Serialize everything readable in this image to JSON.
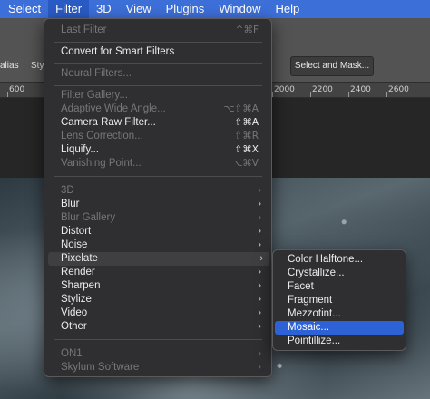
{
  "menubar": {
    "items": [
      "Select",
      "Filter",
      "3D",
      "View",
      "Plugins",
      "Window",
      "Help"
    ],
    "active": "Filter"
  },
  "options_bar": {
    "fragment_1": "alias",
    "fragment_2": "Sty",
    "select_mask_button": "Select and Mask..."
  },
  "ruler": {
    "ticks": [
      "600",
      "2000",
      "2200",
      "2400",
      "2600"
    ]
  },
  "filter_menu": {
    "last_filter": {
      "label": "Last Filter",
      "shortcut": "^⌘F"
    },
    "convert_smart": {
      "label": "Convert for Smart Filters"
    },
    "neural_filters": {
      "label": "Neural Filters..."
    },
    "filter_gallery": {
      "label": "Filter Gallery..."
    },
    "adaptive_wide_angle": {
      "label": "Adaptive Wide Angle...",
      "shortcut": "⌥⇧⌘A"
    },
    "camera_raw": {
      "label": "Camera Raw Filter...",
      "shortcut": "⇧⌘A"
    },
    "lens_correction": {
      "label": "Lens Correction...",
      "shortcut": "⇧⌘R"
    },
    "liquify": {
      "label": "Liquify...",
      "shortcut": "⇧⌘X"
    },
    "vanishing_point": {
      "label": "Vanishing Point...",
      "shortcut": "⌥⌘V"
    },
    "groups": [
      {
        "label": "3D",
        "enabled": false
      },
      {
        "label": "Blur",
        "enabled": true
      },
      {
        "label": "Blur Gallery",
        "enabled": false
      },
      {
        "label": "Distort",
        "enabled": true
      },
      {
        "label": "Noise",
        "enabled": true
      },
      {
        "label": "Pixelate",
        "enabled": true
      },
      {
        "label": "Render",
        "enabled": true
      },
      {
        "label": "Sharpen",
        "enabled": true
      },
      {
        "label": "Stylize",
        "enabled": true
      },
      {
        "label": "Video",
        "enabled": true
      },
      {
        "label": "Other",
        "enabled": true
      }
    ],
    "plugins": [
      {
        "label": "ON1"
      },
      {
        "label": "Skylum Software"
      }
    ],
    "submenu_arrow": "›"
  },
  "pixelate_submenu": {
    "items": [
      "Color Halftone...",
      "Crystallize...",
      "Facet",
      "Fragment",
      "Mezzotint...",
      "Mosaic...",
      "Pointillize..."
    ],
    "highlighted": "Mosaic..."
  }
}
